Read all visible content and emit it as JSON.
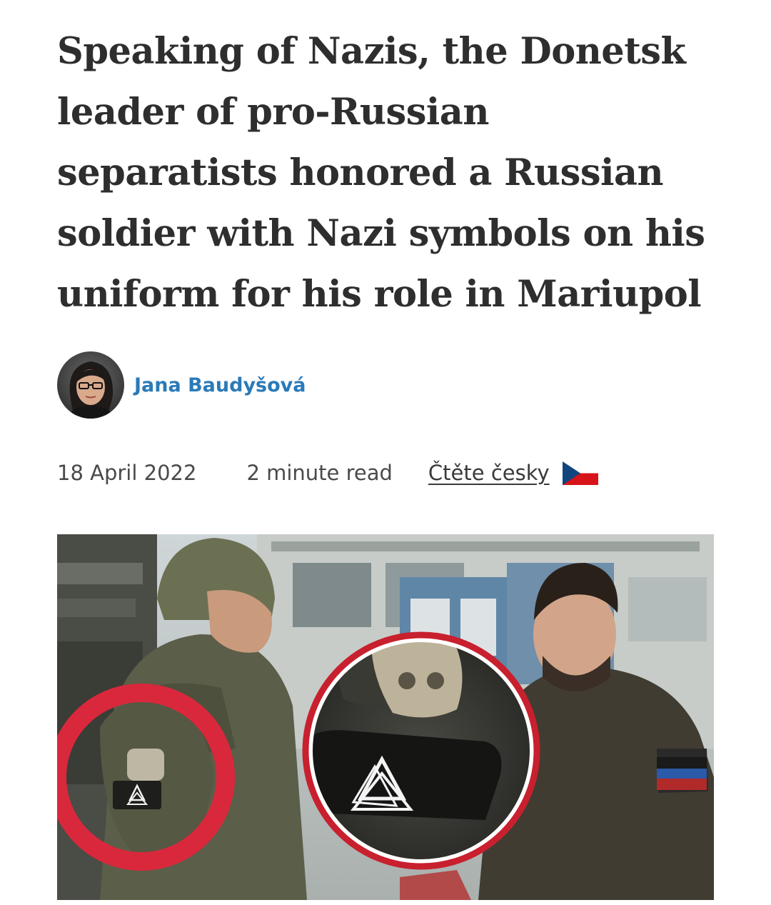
{
  "article": {
    "headline": "Speaking of Nazis, the Donetsk leader of pro-Russian separatists honored a Russian soldier with Nazi symbols on his uniform for his role in Mariupol",
    "author": {
      "name": "Jana Baudyšová"
    },
    "meta": {
      "date": "18 April 2022",
      "read_time": "2 minute read",
      "language_link": "Čtěte česky",
      "language_flag_icon": "czech-flag-icon"
    }
  },
  "colors": {
    "author_link": "#2a7ab8",
    "highlight_circle": "#d9283c",
    "flag_blue": "#11457e",
    "flag_red": "#d7141a"
  }
}
